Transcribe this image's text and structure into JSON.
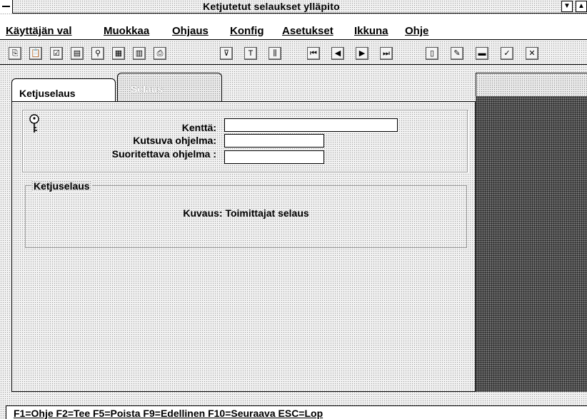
{
  "window": {
    "title": "Ketjutetut selaukset ylläpito"
  },
  "menu": {
    "items": [
      "Käyttäjän val",
      "Muokkaa",
      "Ohjaus",
      "Konfig",
      "Asetukset",
      "Ikkuna",
      "Ohje"
    ]
  },
  "toolbar": {
    "groups": [
      [
        "copy-icon",
        "paste-icon",
        "checkbox-icon",
        "note-icon",
        "zoom-icon",
        "grid-icon",
        "calculator-icon",
        "print-icon"
      ],
      [
        "filter-icon",
        "text-icon",
        "columns-icon"
      ],
      [
        "first-record-icon",
        "prev-record-icon",
        "next-record-icon",
        "last-record-icon"
      ],
      [
        "new-icon",
        "edit-icon",
        "delete-icon",
        "accept-icon",
        "cancel-icon"
      ]
    ],
    "glyphs": {
      "copy-icon": "⎘",
      "paste-icon": "📋",
      "checkbox-icon": "☑",
      "note-icon": "▤",
      "zoom-icon": "⚲",
      "grid-icon": "▦",
      "calculator-icon": "▥",
      "print-icon": "⎙",
      "filter-icon": "⊽",
      "text-icon": "T",
      "columns-icon": "⫼",
      "first-record-icon": "⏮",
      "prev-record-icon": "◀",
      "next-record-icon": "▶",
      "last-record-icon": "⏭",
      "new-icon": "▯",
      "edit-icon": "✎",
      "delete-icon": "▬",
      "accept-icon": "✓",
      "cancel-icon": "✕"
    }
  },
  "tabs": [
    {
      "label": "Ketjuselaus",
      "active": true
    },
    {
      "label": "Selaus",
      "active": false
    }
  ],
  "form": {
    "kentta_label": "Kenttä:",
    "kentta_value": "",
    "kutsuva_label": "Kutsuva ohjelma:",
    "kutsuva_value": "",
    "suoritettava_label": "Suoritettava ohjelma :",
    "suoritettava_value": ""
  },
  "description": {
    "legend": "Ketjuselaus",
    "text": "Kuvaus: Toimittajat selaus"
  },
  "status": {
    "text": "F1=Ohje  F2=Tee  F5=Poista  F9=Edellinen  F10=Seuraava  ESC=Lop"
  }
}
